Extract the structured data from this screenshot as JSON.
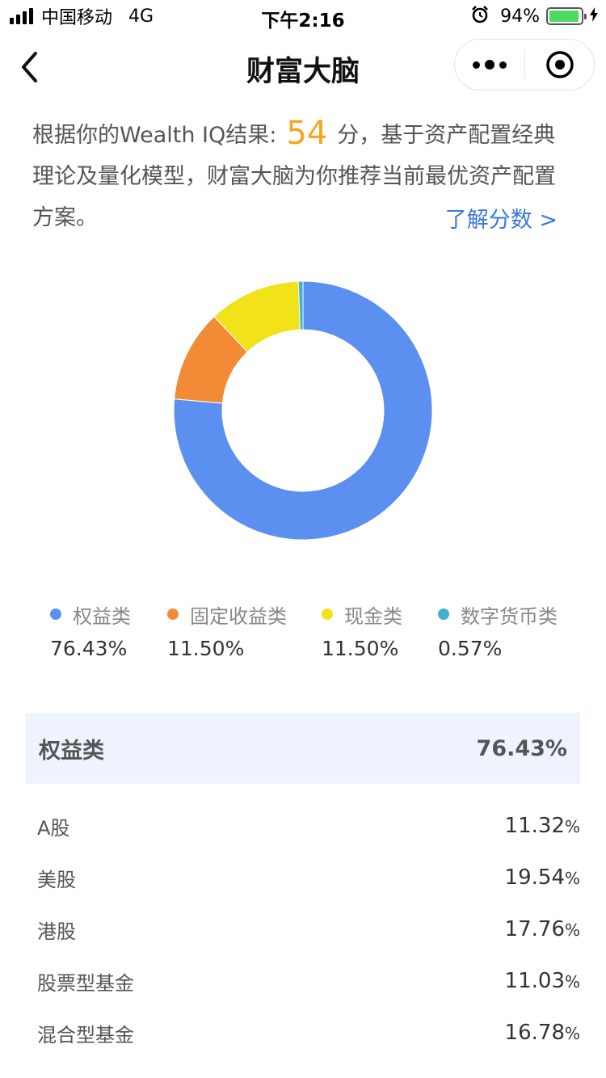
{
  "status_bar": {
    "carrier": "中国移动",
    "network": "4G",
    "time": "下午2:16",
    "battery_text": "94%",
    "battery_level": 0.94,
    "icons": [
      "signal-icon",
      "alarm-icon",
      "battery-icon",
      "charging-icon"
    ]
  },
  "nav": {
    "title": "财富大脑",
    "icons": [
      "back-arrow-icon",
      "more-dots-icon",
      "close-target-icon"
    ]
  },
  "intro": {
    "text_before": "根据你的Wealth IQ结果:",
    "score": "54",
    "text_after": "分，基于资产配置经典理论及量化模型，财富大脑为你推荐当前最优资产配置方案。",
    "link": "了解分数 >"
  },
  "chart_data": {
    "type": "pie",
    "donut": true,
    "start_angle_deg": 0,
    "categories": [
      "权益类",
      "固定收益类",
      "现金类",
      "数字货币类"
    ],
    "values": [
      76.43,
      11.5,
      11.5,
      0.57
    ],
    "colors": [
      "#5b8ff0",
      "#f28a36",
      "#f1e219",
      "#3fb2cc"
    ]
  },
  "legend": [
    {
      "label": "权益类",
      "value": "76.43%",
      "color": "#5b8ff0"
    },
    {
      "label": "固定收益类",
      "value": "11.50%",
      "color": "#f28a36"
    },
    {
      "label": "现金类",
      "value": "11.50%",
      "color": "#f1e219"
    },
    {
      "label": "数字货币类",
      "value": "0.57%",
      "color": "#3fb2cc"
    }
  ],
  "category": {
    "name": "权益类",
    "value": "76.43%",
    "rows": [
      {
        "name": "A股",
        "value": "11.32",
        "unit": "%"
      },
      {
        "name": "美股",
        "value": "19.54",
        "unit": "%"
      },
      {
        "name": "港股",
        "value": "17.76",
        "unit": "%"
      },
      {
        "name": "股票型基金",
        "value": "11.03",
        "unit": "%"
      },
      {
        "name": "混合型基金",
        "value": "16.78",
        "unit": "%"
      }
    ]
  }
}
